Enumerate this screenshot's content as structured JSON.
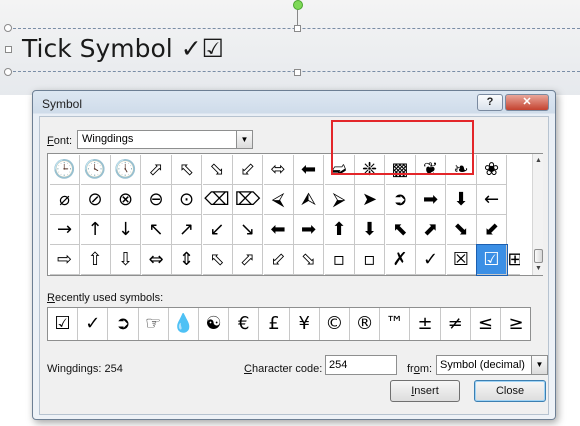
{
  "slide": {
    "title": "Tick Symbol ✓☑"
  },
  "dialog": {
    "title": "Symbol",
    "help_button": "?",
    "close_button": "✕",
    "font_label": "Font:",
    "font_value": "Wingdings",
    "dropdown_arrow": "▼",
    "symbol_grid": [
      [
        "🕒",
        "🕓",
        "🕔",
        "⬀",
        "⬁",
        "⬂",
        "⬃",
        "⬄",
        "⬅",
        "➫",
        "❈",
        "▩",
        "❦",
        "❧",
        "❀"
      ],
      [
        "⌀",
        "⊘",
        "⊗",
        "⊖",
        "⊙",
        "⌫",
        "⌦",
        "⮘",
        "⮙",
        "⮚",
        "➤",
        "➲",
        "➡",
        "⬇",
        "←"
      ],
      [
        "→",
        "↑",
        "↓",
        "↖",
        "↗",
        "↙",
        "↘",
        "⬅",
        "➡",
        "⬆",
        "⬇",
        "⬉",
        "⬈",
        "⬊",
        "⬋"
      ],
      [
        "⇨",
        "⇧",
        "⇩",
        "⇔",
        "⇕",
        "⬁",
        "⬀",
        "⬃",
        "⬂",
        "▫",
        "▫",
        "✗",
        "✓",
        "☒",
        "☑"
      ]
    ],
    "selected_symbol": "☑",
    "partial_symbol": "⊞",
    "recent_label": "Recently used symbols:",
    "recent_symbols": [
      "☑",
      "✓",
      "➲",
      "☞",
      "💧",
      "☯",
      "€",
      "£",
      "¥",
      "©",
      "®",
      "™",
      "±",
      "≠",
      "≤",
      "≥"
    ],
    "status_text": "Wingdings: 254",
    "character_code_label": "Character code:",
    "character_code_value": "254",
    "from_label": "from:",
    "from_value": "Symbol (decimal)",
    "insert_button": "Insert",
    "close_label": "Close"
  }
}
